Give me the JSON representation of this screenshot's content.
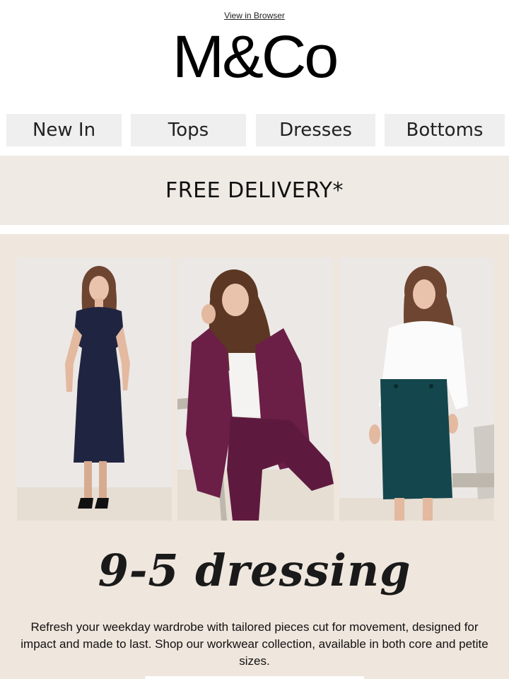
{
  "header": {
    "view_in_browser": "View in Browser",
    "logo": "M&Co"
  },
  "nav": {
    "items": [
      {
        "label": "New In"
      },
      {
        "label": "Tops"
      },
      {
        "label": "Dresses"
      },
      {
        "label": "Bottoms"
      }
    ]
  },
  "banner": {
    "text": "FREE DELIVERY*"
  },
  "hero": {
    "headline": "9-5 dressing",
    "body": "Refresh your weekday wardrobe with tailored pieces cut for movement, designed for impact and made to last. Shop our workwear collection, available in both core and petite sizes.",
    "background_color": "#efe6dd",
    "photos": [
      {
        "subject": "navy-wrap-dress",
        "garment_color": "#1f2541"
      },
      {
        "subject": "plum-suit",
        "garment_color": "#6b1f47"
      },
      {
        "subject": "white-top-teal-skirt",
        "garment_color": "#14464d"
      }
    ]
  },
  "colors": {
    "nav_bg": "#efefef",
    "banner_bg": "#efeae4"
  }
}
